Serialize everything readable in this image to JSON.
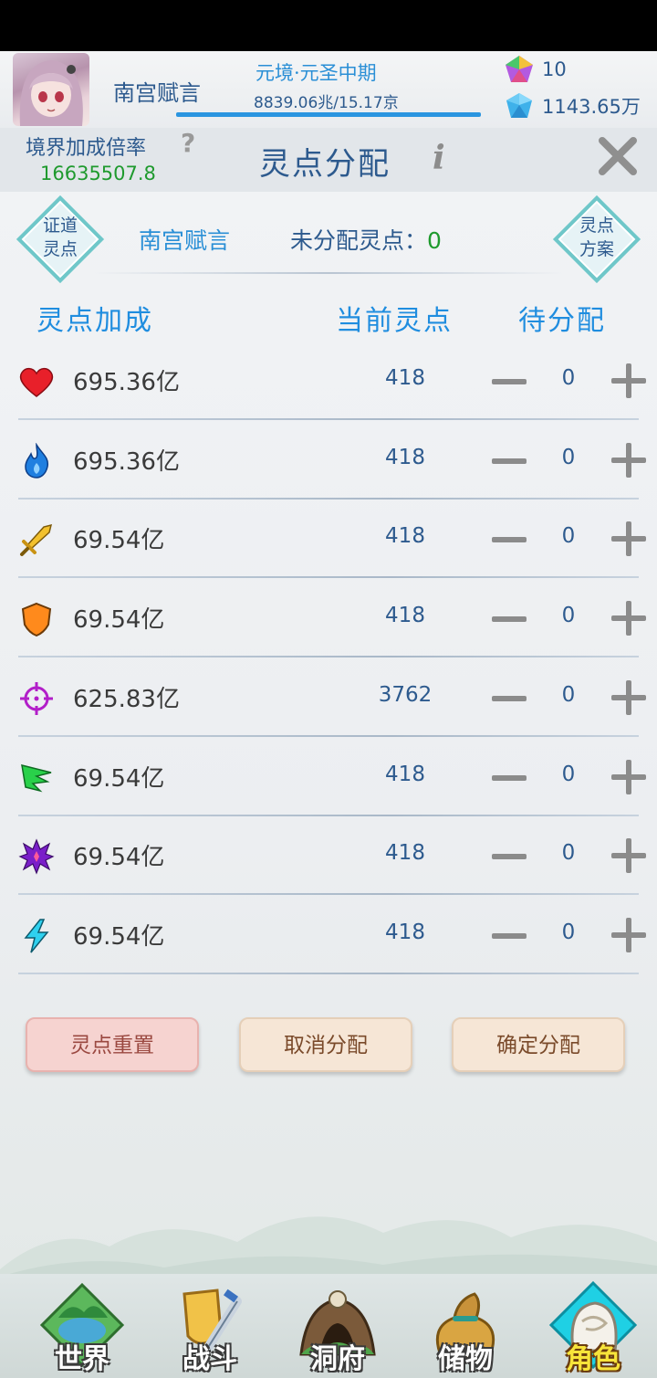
{
  "header": {
    "player_name": "南宫赋言",
    "realm": "元境·元圣中期",
    "exp_text": "8839.06兆/15.17京",
    "exp_progress": 1.0,
    "currency_1": "10",
    "currency_2": "1143.65万"
  },
  "title": {
    "bonus_label": "境界加成倍率",
    "bonus_value": "16635507.8",
    "panel_title": "灵点分配",
    "help_glyph": "?",
    "info_glyph": "i"
  },
  "top": {
    "left_button": [
      "证道",
      "灵点"
    ],
    "right_button": [
      "灵点",
      "方案"
    ],
    "role_name": "南宫赋言",
    "unassigned_label": "未分配灵点：",
    "unassigned_value": "0"
  },
  "columns": {
    "bonus": "灵点加成",
    "current": "当前灵点",
    "pending": "待分配"
  },
  "attributes": [
    {
      "icon": "heart-icon",
      "bonus": "695.36亿",
      "points": "418",
      "pending": "0"
    },
    {
      "icon": "flame-icon",
      "bonus": "695.36亿",
      "points": "418",
      "pending": "0"
    },
    {
      "icon": "sword-icon",
      "bonus": "69.54亿",
      "points": "418",
      "pending": "0"
    },
    {
      "icon": "shield-icon",
      "bonus": "69.54亿",
      "points": "418",
      "pending": "0"
    },
    {
      "icon": "crosshair-icon",
      "bonus": "625.83亿",
      "points": "3762",
      "pending": "0"
    },
    {
      "icon": "wing-icon",
      "bonus": "69.54亿",
      "points": "418",
      "pending": "0"
    },
    {
      "icon": "burst-icon",
      "bonus": "69.54亿",
      "points": "418",
      "pending": "0"
    },
    {
      "icon": "lightning-icon",
      "bonus": "69.54亿",
      "points": "418",
      "pending": "0"
    }
  ],
  "buttons": {
    "reset": "灵点重置",
    "cancel": "取消分配",
    "confirm": "确定分配"
  },
  "nav": [
    {
      "label": "世界",
      "icon": "world-island-icon"
    },
    {
      "label": "战斗",
      "icon": "battle-sword-shield-icon"
    },
    {
      "label": "洞府",
      "icon": "cave-icon"
    },
    {
      "label": "储物",
      "icon": "storage-bag-icon"
    },
    {
      "label": "角色",
      "icon": "character-icon",
      "active": true
    }
  ],
  "colors": {
    "accent_blue": "#1f8ddf",
    "text_blue": "#2d5a8e",
    "green": "#1f9a2e"
  }
}
